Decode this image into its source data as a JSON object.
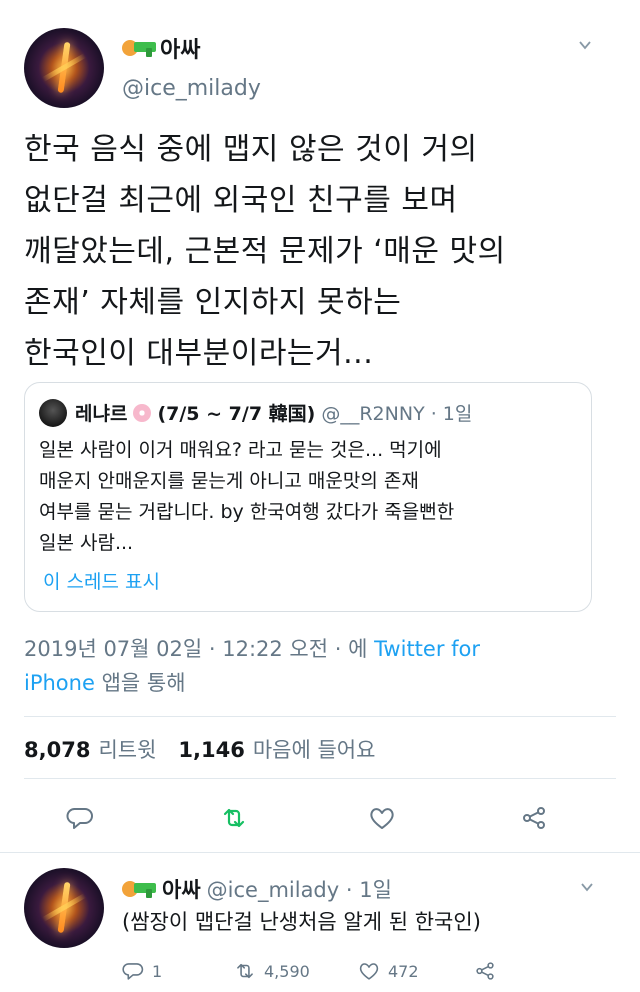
{
  "tweet": {
    "display_name": "아싸",
    "handle": "@ice_milady",
    "text": "한국 음식 중에 맵지 않은 것이 거의\n없단걸 최근에 외국인 친구를 보며\n깨달았는데, 근본적 문제가 ‘매운 맛의\n존재’ 자체를 인지하지 못하는\n한국인이 대부분이라는거...",
    "quoted": {
      "display_name": "레냐르",
      "name_suffix": "(7/5 ~ 7/7 韓国)",
      "handle_time": "@__R2NNY · 1일",
      "text": "일본 사람이 이거 매워요? 라고 묻는 것은... 먹기에\n매운지 안매운지를 묻는게 아니고 매운맛의 존재\n여부를 묻는 거랍니다. by 한국여행 갔다가 죽을뻔한\n일본 사람...",
      "show_thread": "이 스레드 표시"
    },
    "timestamp": "2019년 07월 02일 · 12:22 오전 · 에 ",
    "source_link": "Twitter for",
    "source_link2": "iPhone",
    "source_suffix": " 앱을 통해",
    "retweet_count": "8,078",
    "retweet_label": "리트윗",
    "like_count": "1,146",
    "like_label": "마음에 들어요"
  },
  "reply": {
    "display_name": "아싸",
    "handle_time": "@ice_milady · 1일",
    "text": "(쌈장이 맵단걸 난생처음 알게 된 한국인)",
    "reply_count": "1",
    "retweet_count": "4,590",
    "like_count": "472"
  },
  "colors": {
    "accent": "#1da1f2",
    "retweet": "#17bf63",
    "muted": "#657786",
    "text": "#14171a"
  },
  "icons": [
    "chevron-down-icon",
    "reply-icon",
    "retweet-icon",
    "like-icon",
    "share-icon"
  ]
}
